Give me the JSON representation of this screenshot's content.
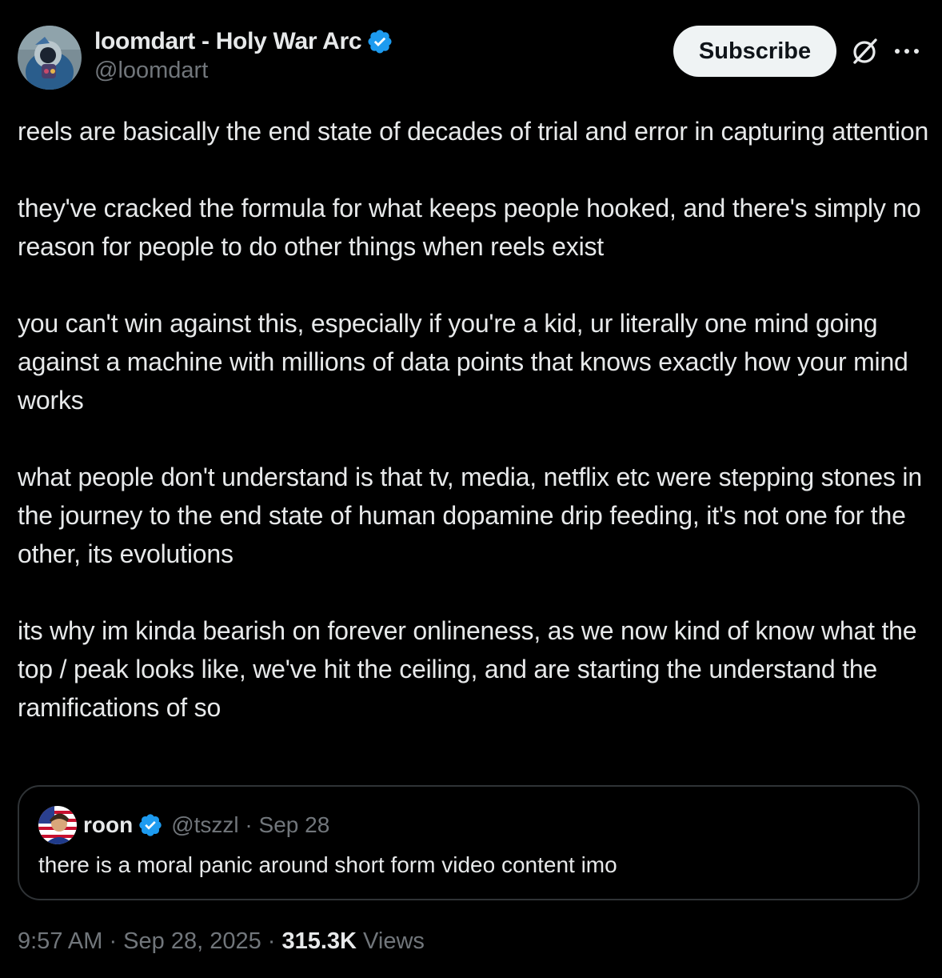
{
  "author": {
    "display_name": "loomdart - Holy War Arc",
    "handle": "@loomdart",
    "verified": true,
    "avatar_icon": "astronaut-avatar"
  },
  "header": {
    "subscribe_label": "Subscribe",
    "grok_icon": "grok-icon",
    "more_icon": "more-options-icon"
  },
  "tweet": {
    "paragraphs": [
      "reels are basically the end state of decades of trial and error in capturing attention",
      "they've cracked the formula for what keeps people hooked, and there's simply no reason for people to do other things when reels exist",
      "you can't win against this, especially if you're a kid, ur literally one mind going against a machine with millions of data points that knows exactly how your mind works",
      "what people don't understand is that tv, media, netflix etc were stepping stones in the journey to the end state of human dopamine drip feeding, it's not one for the other, its evolutions",
      "its why im kinda bearish on forever onlineness, as we now kind of know what the top / peak looks like, we've hit the ceiling, and are starting the understand the ramifications of so"
    ]
  },
  "quote": {
    "display_name": "roon",
    "verified": true,
    "meta": "@tszzl · Sep 28",
    "text": "there is a moral panic around short form video content imo",
    "avatar_icon": "flag-avatar"
  },
  "footer": {
    "timestamp": "9:57 AM · Sep 28, 2025 · ",
    "views_count": "315.3K",
    "views_label": " Views"
  },
  "colors": {
    "background": "#000000",
    "text_primary": "#e7e9ea",
    "text_secondary": "#71767b",
    "verified_blue": "#1d9bf0",
    "border": "#2f3336"
  }
}
